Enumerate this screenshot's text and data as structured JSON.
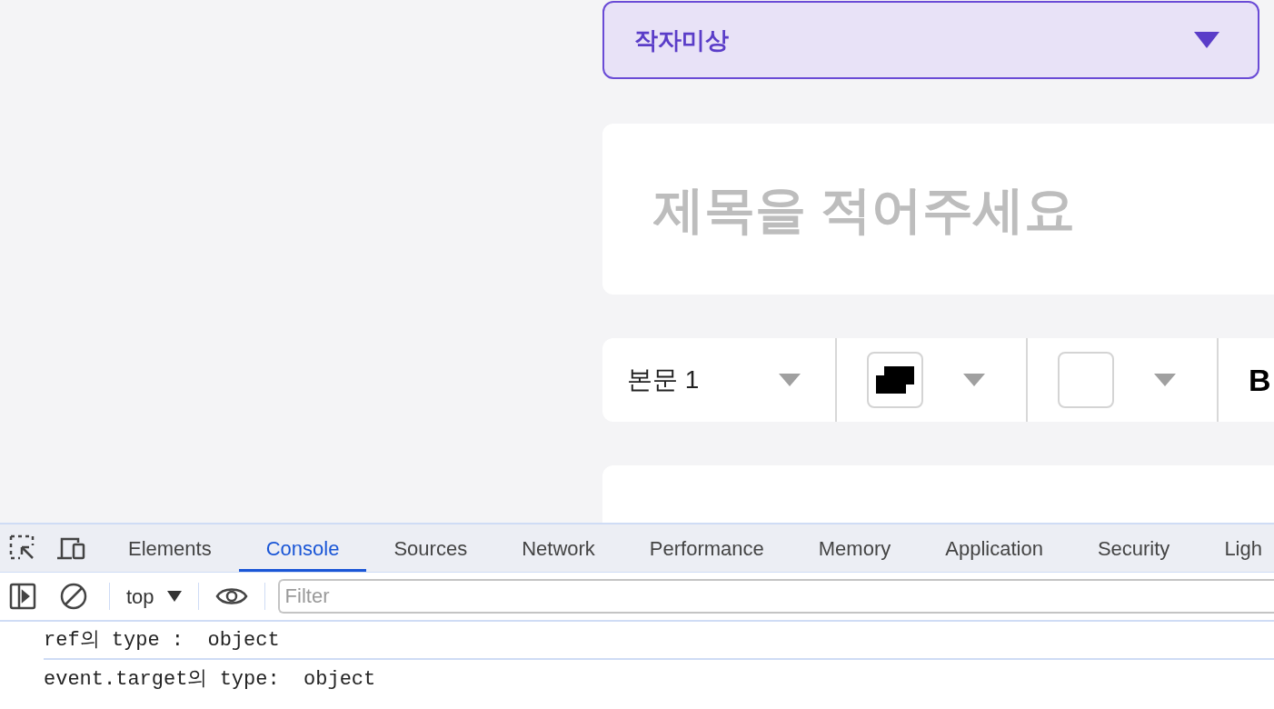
{
  "author_select": {
    "value": "작자미상"
  },
  "title_field": {
    "placeholder": "제목을 적어주세요"
  },
  "toolbar": {
    "text_style": "본문 1",
    "bold": "B"
  },
  "devtools": {
    "tabs": [
      {
        "label": "Elements",
        "selected": false
      },
      {
        "label": "Console",
        "selected": true
      },
      {
        "label": "Sources",
        "selected": false
      },
      {
        "label": "Network",
        "selected": false
      },
      {
        "label": "Performance",
        "selected": false
      },
      {
        "label": "Memory",
        "selected": false
      },
      {
        "label": "Application",
        "selected": false
      },
      {
        "label": "Security",
        "selected": false
      },
      {
        "label": "Ligh",
        "selected": false
      }
    ],
    "context": "top",
    "filter": {
      "placeholder": "Filter"
    },
    "messages": [
      "ref의 type :  object",
      "event.target의 type:  object"
    ]
  }
}
